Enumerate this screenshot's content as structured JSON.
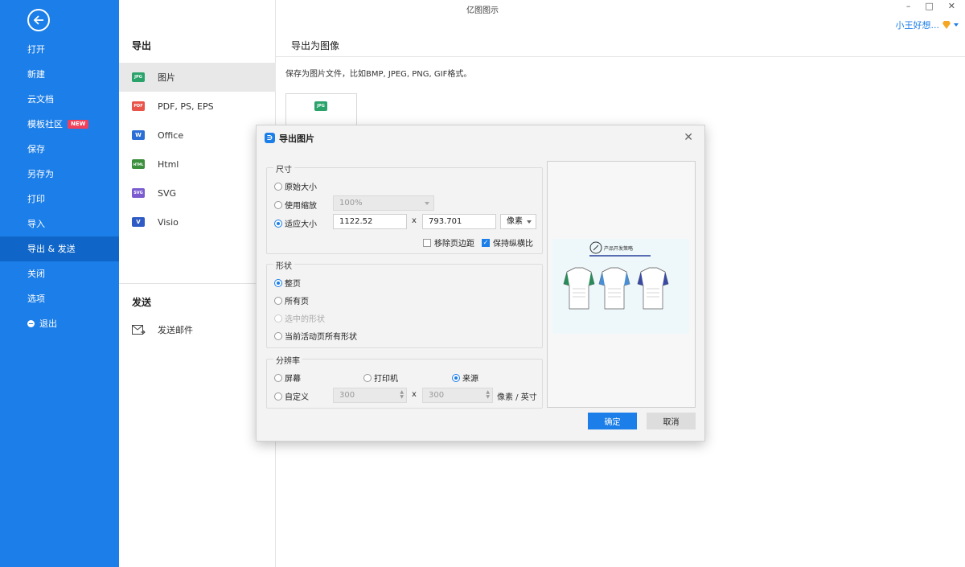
{
  "window": {
    "title": "亿图图示",
    "controls": [
      "–",
      "□",
      "✕"
    ],
    "user_name": "小王好想...",
    "user_badge_color": "#f5a623"
  },
  "sidebar": {
    "items": [
      {
        "label": "打开"
      },
      {
        "label": "新建"
      },
      {
        "label": "云文档"
      },
      {
        "label": "模板社区",
        "badge": "NEW"
      },
      {
        "label": "保存"
      },
      {
        "label": "另存为"
      },
      {
        "label": "打印"
      },
      {
        "label": "导入"
      },
      {
        "label": "导出 & 发送",
        "active": true
      },
      {
        "label": "关闭"
      },
      {
        "label": "选项"
      },
      {
        "label": "退出"
      }
    ]
  },
  "export_panel": {
    "heading": "导出",
    "items": [
      {
        "label": "图片",
        "icon": "JPG",
        "color": "#2aa36b"
      },
      {
        "label": "PDF, PS, EPS",
        "icon": "PDF",
        "color": "#e8534a"
      },
      {
        "label": "Office",
        "icon": "W",
        "color": "#2b6fd6"
      },
      {
        "label": "Html",
        "icon": "HTML",
        "color": "#3c8f3c"
      },
      {
        "label": "SVG",
        "icon": "SVG",
        "color": "#7b5ccf"
      },
      {
        "label": "Visio",
        "icon": "V",
        "color": "#2f5bc4"
      }
    ],
    "send_heading": "发送",
    "send_item": "发送邮件"
  },
  "content": {
    "heading": "导出为图像",
    "description": "保存为图片文件，比如BMP, JPEG, PNG, GIF格式。",
    "thumb_icon": "JPG"
  },
  "dialog": {
    "title": "导出图片",
    "size_group": {
      "label": "尺寸",
      "original": "原始大小",
      "zoom": "使用缩放",
      "zoom_value": "100%",
      "fit": "适应大小",
      "width": "1122.52",
      "times": "x",
      "height": "793.701",
      "unit": "像素",
      "remove_margin": "移除页边距",
      "keep_ratio": "保持纵横比"
    },
    "shape_group": {
      "label": "形状",
      "whole_page": "整页",
      "all_pages": "所有页",
      "selected": "选中的形状",
      "active_page": "当前活动页所有形状"
    },
    "resolution_group": {
      "label": "分辨率",
      "screen": "屏幕",
      "printer": "打印机",
      "source": "来源",
      "custom": "自定义",
      "x_value": "300",
      "times": "x",
      "y_value": "300",
      "unit": "像素 / 英寸"
    },
    "preview_title": "产品开发策略",
    "ok": "确定",
    "cancel": "取消"
  }
}
